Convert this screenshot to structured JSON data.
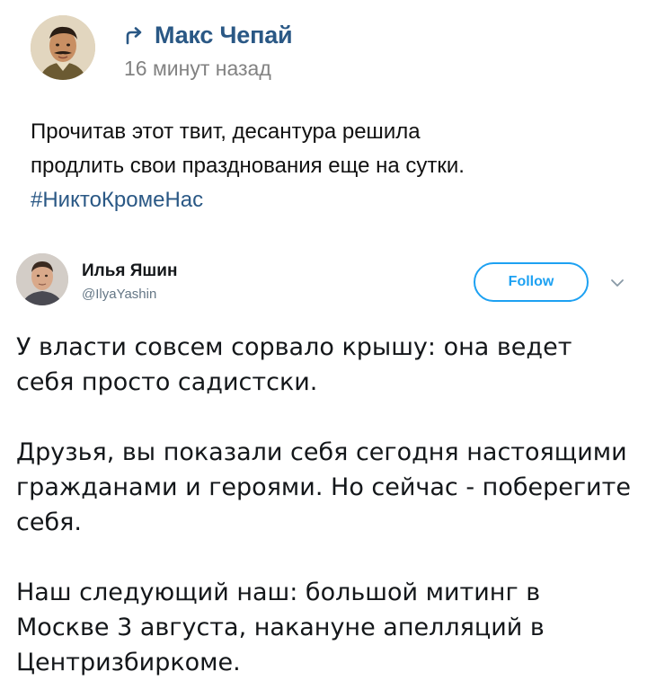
{
  "vk_post": {
    "author_name": "Макс Чепай",
    "timestamp": "16 минут назад",
    "text_line_1": "Прочитав этот твит, десантура решила",
    "text_line_2": "продлить свои празднования еще на сутки.",
    "hashtag": "#НиктоКромеНас",
    "link_color": "#2a5885",
    "icons": [
      "repost-icon"
    ]
  },
  "tweet": {
    "author_name": "Илья Яшин",
    "handle": "@IlyaYashin",
    "follow_label": "Follow",
    "accent_color": "#1da1f2",
    "icons": [
      "chevron-down-icon"
    ],
    "paragraphs": [
      "У власти совсем сорвало крышу: она ведет себя просто садистски.",
      "Друзья, вы показали себя сегодня настоящими гражданами и героями. Но сейчас - поберегите себя.",
      "Наш следующий наш: большой митинг в Москве 3 августа, накануне апелляций в Центризбиркоме."
    ]
  }
}
